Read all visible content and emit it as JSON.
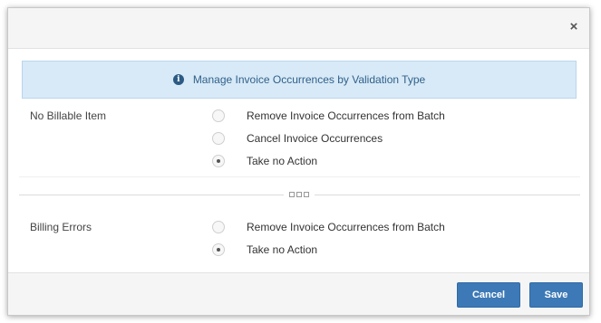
{
  "header": {
    "close_icon": "close-icon",
    "close_glyph": "×"
  },
  "banner": {
    "icon": "info-icon",
    "icon_glyph": "i",
    "text": "Manage Invoice Occurrences by Validation Type"
  },
  "sections": [
    {
      "label": "No Billable Item",
      "options": [
        {
          "label": "Remove Invoice Occurrences from Batch",
          "checked": false
        },
        {
          "label": "Cancel Invoice Occurrences",
          "checked": false
        },
        {
          "label": "Take no Action",
          "checked": true
        }
      ]
    },
    {
      "label": "Billing Errors",
      "options": [
        {
          "label": "Remove Invoice Occurrences from Batch",
          "checked": false
        },
        {
          "label": "Take no Action",
          "checked": true
        }
      ]
    }
  ],
  "footer": {
    "cancel_label": "Cancel",
    "save_label": "Save"
  }
}
